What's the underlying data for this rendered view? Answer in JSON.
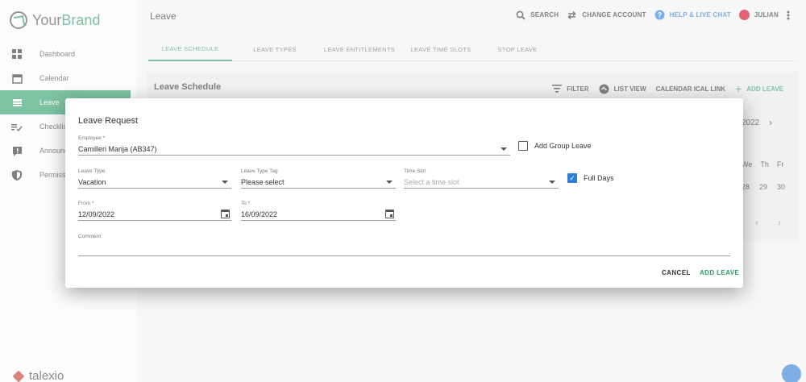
{
  "brand": {
    "name_a": "Your",
    "name_b": "Brand",
    "footer": "talexio"
  },
  "sidebar": {
    "items": [
      {
        "label": "Dashboard",
        "icon": "dashboard-icon"
      },
      {
        "label": "Calendar",
        "icon": "calendar-icon"
      },
      {
        "label": "Leave",
        "icon": "leave-icon",
        "active": true
      },
      {
        "label": "Checklis",
        "icon": "checklist-icon"
      },
      {
        "label": "Announc",
        "icon": "announcement-icon"
      },
      {
        "label": "Permissi",
        "icon": "shield-icon"
      }
    ]
  },
  "topbar": {
    "title": "Leave",
    "search": "SEARCH",
    "change_account": "CHANGE ACCOUNT",
    "help": "HELP & LIVE CHAT",
    "user": "JULIAN"
  },
  "tabs": [
    "LEAVE SCHEDULE",
    "LEAVE TYPES",
    "LEAVE ENTITLEMENTS",
    "LEAVE TIME SLOTS",
    "STOP LEAVE"
  ],
  "panel": {
    "title": "Leave Schedule",
    "filter": "FILTER",
    "list_view": "LIST VIEW",
    "ical": "CALENDAR ICAL LINK",
    "add_leave": "ADD LEAVE",
    "month_fragment": "2022",
    "day_headers": [
      "We",
      "Th",
      "Fr"
    ],
    "day_numbers": [
      "28",
      "29",
      "30"
    ]
  },
  "dialog": {
    "title": "Leave Request",
    "employee": {
      "label": "Employee *",
      "value": "Camilleri Marija (AB347)"
    },
    "group_leave": {
      "label": "Add Group Leave",
      "checked": false
    },
    "leave_type": {
      "label": "Leave Type",
      "value": "Vacation"
    },
    "leave_type_tag": {
      "label": "Leave Type Tag",
      "value": "Please select"
    },
    "time_slot": {
      "label": "Time Slot",
      "placeholder": "Select a time slot"
    },
    "full_days": {
      "label": "Full Days",
      "checked": true
    },
    "from": {
      "label": "From *",
      "value": "12/09/2022"
    },
    "to": {
      "label": "To *",
      "value": "16/09/2022"
    },
    "comment": {
      "label": "Comment",
      "value": ""
    },
    "cancel": "CANCEL",
    "submit": "ADD LEAVE"
  },
  "colors": {
    "primary": "#2e9e6b",
    "link": "#2e7dd6",
    "avatar": "#d0021b"
  }
}
